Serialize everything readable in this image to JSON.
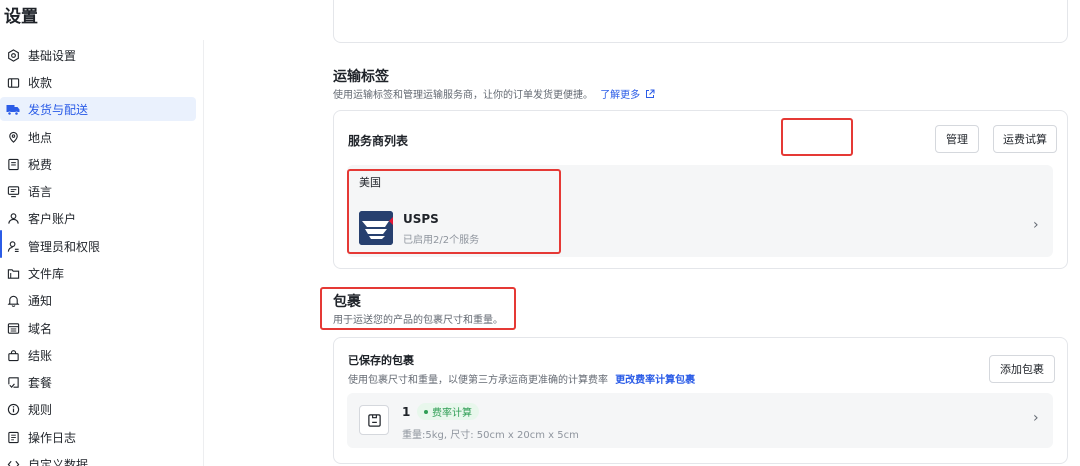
{
  "page": {
    "title": "设置"
  },
  "sidebar": {
    "items": [
      {
        "label": "基础设置",
        "icon": "settings-icon"
      },
      {
        "label": "收款",
        "icon": "wallet-icon"
      },
      {
        "label": "发货与配送",
        "icon": "truck-icon",
        "active": true
      },
      {
        "label": "地点",
        "icon": "location-pin-icon"
      },
      {
        "label": "税费",
        "icon": "receipt-icon"
      },
      {
        "label": "语言",
        "icon": "language-icon"
      },
      {
        "label": "客户账户",
        "icon": "user-icon"
      },
      {
        "label": "管理员和权限",
        "icon": "admin-user-icon"
      },
      {
        "label": "文件库",
        "icon": "folder-icon"
      },
      {
        "label": "通知",
        "icon": "bell-icon"
      },
      {
        "label": "域名",
        "icon": "domain-icon"
      },
      {
        "label": "结账",
        "icon": "bag-icon"
      },
      {
        "label": "套餐",
        "icon": "plan-icon"
      },
      {
        "label": "规则",
        "icon": "info-icon"
      },
      {
        "label": "操作日志",
        "icon": "log-icon"
      },
      {
        "label": "自定义数据",
        "icon": "code-icon"
      }
    ]
  },
  "shipping_labels": {
    "title": "运输标签",
    "description": "使用运输标签和管理运输服务商，让你的订单发货更便捷。",
    "learn_more": "了解更多",
    "card": {
      "title": "服务商列表",
      "manage_button": "管理",
      "rate_button": "运费试算",
      "country": "美国",
      "carrier": {
        "name": "USPS",
        "status": "已启用2/2个服务"
      }
    }
  },
  "packages": {
    "title": "包裹",
    "description": "用于运送您的产品的包裹尺寸和重量。",
    "card": {
      "title": "已保存的包裹",
      "description": "使用包裹尺寸和重量，以便第三方承运商更准确的计算费率",
      "link": "更改费率计算包裹",
      "add_button": "添加包裹",
      "item": {
        "name": "1",
        "badge": "费率计算",
        "details": "重量:5kg, 尺寸: 50cm x 20cm x 5cm"
      }
    }
  },
  "colors": {
    "accent": "#2b5ce7",
    "highlight_box": "#e53935",
    "badge_green": "#2f9e55",
    "usps_blue": "#27406f"
  }
}
